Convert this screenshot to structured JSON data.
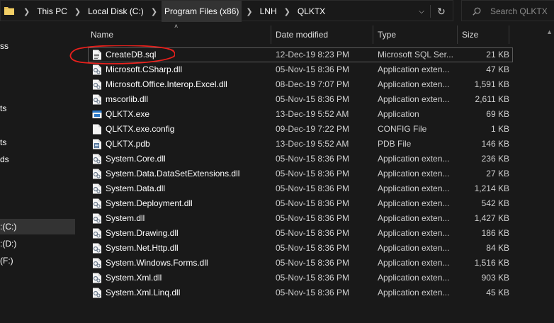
{
  "breadcrumb": [
    "This PC",
    "Local Disk (C:)",
    "Program Files (x86)",
    "LNH",
    "QLKTX"
  ],
  "search": {
    "placeholder": "Search QLKTX"
  },
  "nav_items": [
    "ss",
    "ts",
    "ts",
    "ds",
    ":(C:)",
    ":(D:)",
    "(F:)"
  ],
  "columns": {
    "name": "Name",
    "date": "Date modified",
    "type": "Type",
    "size": "Size"
  },
  "files": [
    {
      "name": "CreateDB.sql",
      "date": "12-Dec-19 8:23 PM",
      "type": "Microsoft SQL Ser...",
      "size": "21 KB",
      "icon": "sql-file-icon"
    },
    {
      "name": "Microsoft.CSharp.dll",
      "date": "05-Nov-15 8:36 PM",
      "type": "Application exten...",
      "size": "47 KB",
      "icon": "dll-file-icon"
    },
    {
      "name": "Microsoft.Office.Interop.Excel.dll",
      "date": "08-Dec-19 7:07 PM",
      "type": "Application exten...",
      "size": "1,591 KB",
      "icon": "dll-file-icon"
    },
    {
      "name": "mscorlib.dll",
      "date": "05-Nov-15 8:36 PM",
      "type": "Application exten...",
      "size": "2,611 KB",
      "icon": "dll-file-icon"
    },
    {
      "name": "QLKTX.exe",
      "date": "13-Dec-19 5:52 AM",
      "type": "Application",
      "size": "69 KB",
      "icon": "exe-file-icon"
    },
    {
      "name": "QLKTX.exe.config",
      "date": "09-Dec-19 7:22 PM",
      "type": "CONFIG File",
      "size": "1 KB",
      "icon": "config-file-icon"
    },
    {
      "name": "QLKTX.pdb",
      "date": "13-Dec-19 5:52 AM",
      "type": "PDB File",
      "size": "146 KB",
      "icon": "pdb-file-icon"
    },
    {
      "name": "System.Core.dll",
      "date": "05-Nov-15 8:36 PM",
      "type": "Application exten...",
      "size": "236 KB",
      "icon": "dll-file-icon"
    },
    {
      "name": "System.Data.DataSetExtensions.dll",
      "date": "05-Nov-15 8:36 PM",
      "type": "Application exten...",
      "size": "27 KB",
      "icon": "dll-file-icon"
    },
    {
      "name": "System.Data.dll",
      "date": "05-Nov-15 8:36 PM",
      "type": "Application exten...",
      "size": "1,214 KB",
      "icon": "dll-file-icon"
    },
    {
      "name": "System.Deployment.dll",
      "date": "05-Nov-15 8:36 PM",
      "type": "Application exten...",
      "size": "542 KB",
      "icon": "dll-file-icon"
    },
    {
      "name": "System.dll",
      "date": "05-Nov-15 8:36 PM",
      "type": "Application exten...",
      "size": "1,427 KB",
      "icon": "dll-file-icon"
    },
    {
      "name": "System.Drawing.dll",
      "date": "05-Nov-15 8:36 PM",
      "type": "Application exten...",
      "size": "186 KB",
      "icon": "dll-file-icon"
    },
    {
      "name": "System.Net.Http.dll",
      "date": "05-Nov-15 8:36 PM",
      "type": "Application exten...",
      "size": "84 KB",
      "icon": "dll-file-icon"
    },
    {
      "name": "System.Windows.Forms.dll",
      "date": "05-Nov-15 8:36 PM",
      "type": "Application exten...",
      "size": "1,516 KB",
      "icon": "dll-file-icon"
    },
    {
      "name": "System.Xml.dll",
      "date": "05-Nov-15 8:36 PM",
      "type": "Application exten...",
      "size": "903 KB",
      "icon": "dll-file-icon"
    },
    {
      "name": "System.Xml.Linq.dll",
      "date": "05-Nov-15 8:36 PM",
      "type": "Application exten...",
      "size": "45 KB",
      "icon": "dll-file-icon"
    }
  ],
  "colors": {
    "background": "#191919",
    "selected_row_border": "#5a5a5a",
    "annotation_red": "#e8201c",
    "folder_yellow": "#e8c25a"
  }
}
